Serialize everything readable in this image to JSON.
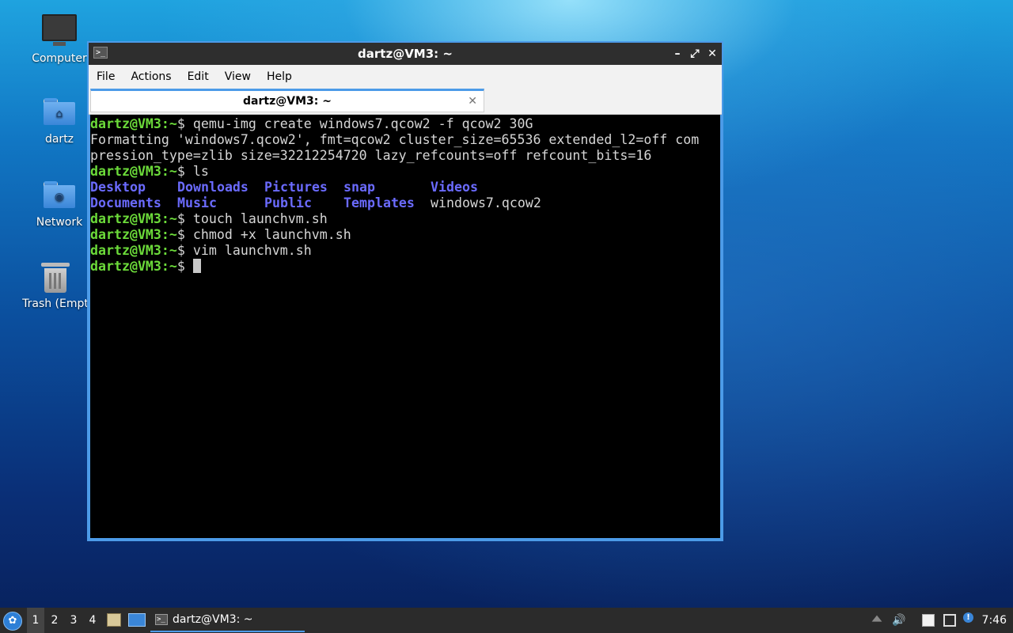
{
  "desktop": {
    "icons": [
      {
        "label": "Computer",
        "icon": "computer-icon"
      },
      {
        "label": "dartz",
        "icon": "home-folder-icon"
      },
      {
        "label": "Network",
        "icon": "network-folder-icon"
      },
      {
        "label": "Trash (Empt",
        "icon": "trash-icon"
      }
    ]
  },
  "window": {
    "title": "dartz@VM3: ~",
    "controls": {
      "minimize": "–",
      "maximize": "⤢",
      "close": "✕"
    },
    "menu": [
      "File",
      "Actions",
      "Edit",
      "View",
      "Help"
    ],
    "tab": {
      "title": "dartz@VM3: ~",
      "close": "✕"
    }
  },
  "terminal": {
    "prompt_user": "dartz@VM3",
    "prompt_path": ":~",
    "prompt_symbol": "$",
    "lines": [
      {
        "kind": "cmd",
        "text": " qemu-img create windows7.qcow2 -f qcow2 30G"
      },
      {
        "kind": "out",
        "text": "Formatting 'windows7.qcow2', fmt=qcow2 cluster_size=65536 extended_l2=off com"
      },
      {
        "kind": "out",
        "text": "pression_type=zlib size=32212254720 lazy_refcounts=off refcount_bits=16"
      },
      {
        "kind": "cmd",
        "text": " ls"
      },
      {
        "kind": "ls",
        "items": [
          {
            "name": "Desktop",
            "dir": true
          },
          {
            "name": "Downloads",
            "dir": true
          },
          {
            "name": "Pictures",
            "dir": true
          },
          {
            "name": "snap",
            "dir": true
          },
          {
            "name": "Videos",
            "dir": true
          }
        ]
      },
      {
        "kind": "ls",
        "items": [
          {
            "name": "Documents",
            "dir": true
          },
          {
            "name": "Music",
            "dir": true
          },
          {
            "name": "Public",
            "dir": true
          },
          {
            "name": "Templates",
            "dir": true
          },
          {
            "name": "windows7.qcow2",
            "dir": false
          }
        ]
      },
      {
        "kind": "cmd",
        "text": " touch launchvm.sh"
      },
      {
        "kind": "cmd",
        "text": " chmod +x launchvm.sh"
      },
      {
        "kind": "cmd",
        "text": " vim launchvm.sh"
      },
      {
        "kind": "cmd",
        "text": " ",
        "cursor": true
      }
    ]
  },
  "taskbar": {
    "workspaces": [
      "1",
      "2",
      "3",
      "4"
    ],
    "active_workspace": "1",
    "task": {
      "label": "dartz@VM3: ~"
    },
    "clock": "7:46",
    "tray_icons": [
      "eject-icon",
      "volume-icon",
      "clipboard-icon",
      "network-icon",
      "update-notifier-icon"
    ]
  }
}
